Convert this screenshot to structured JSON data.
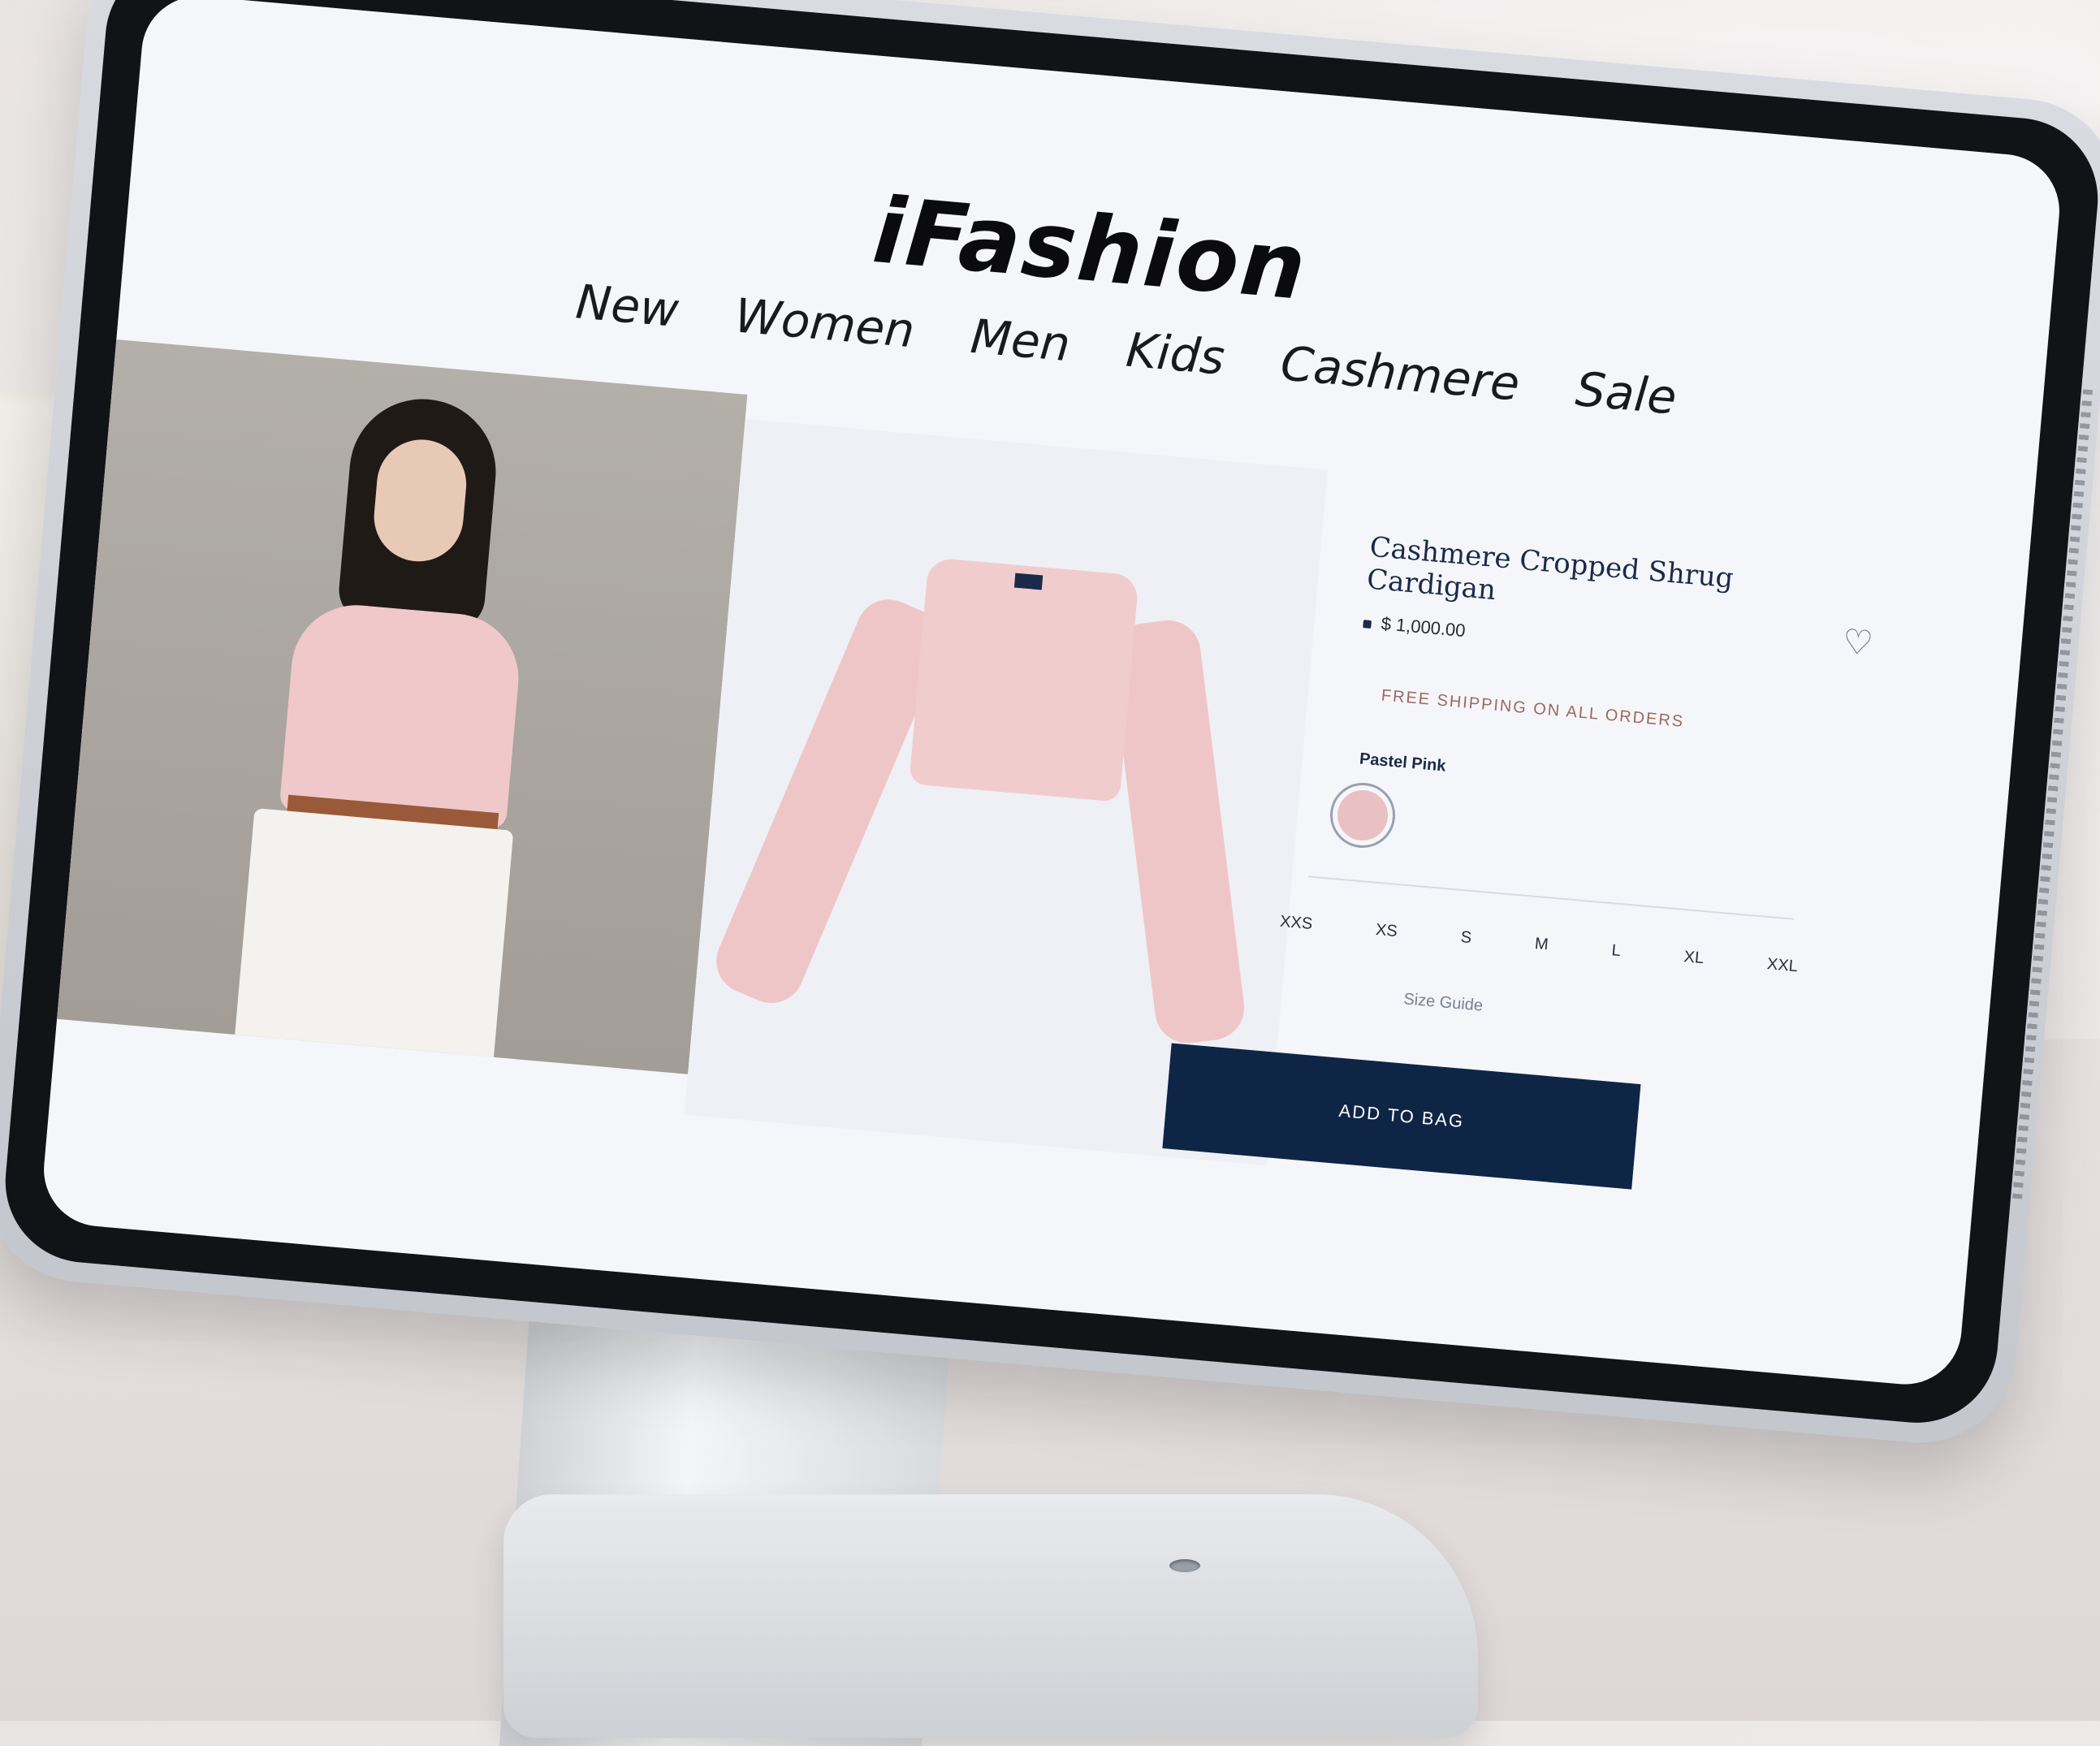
{
  "site": {
    "brand": "iFashion"
  },
  "nav": [
    {
      "label": "New"
    },
    {
      "label": "Women"
    },
    {
      "label": "Men"
    },
    {
      "label": "Kids"
    },
    {
      "label": "Cashmere"
    },
    {
      "label": "Sale"
    }
  ],
  "product": {
    "title": "Cashmere Cropped Shrug Cardigan",
    "price": "$ 1,000.00",
    "shipping_note": "FREE SHIPPING ON ALL ORDERS",
    "color_label": "Pastel Pink",
    "swatch_color": "#e9c0c3",
    "sizes": [
      "XXS",
      "XS",
      "S",
      "M",
      "L",
      "XL",
      "XXL"
    ],
    "size_guide": "Size Guide",
    "add_button": "ADD TO BAG"
  },
  "colors": {
    "accent": "#0f2546"
  }
}
